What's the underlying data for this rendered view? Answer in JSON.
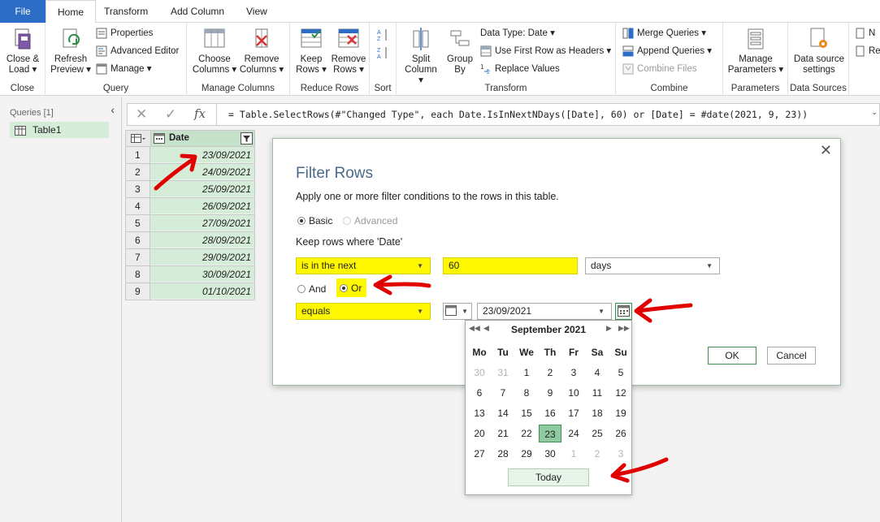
{
  "tabs": [
    {
      "label": "File"
    },
    {
      "label": "Home"
    },
    {
      "label": "Transform"
    },
    {
      "label": "Add Column"
    },
    {
      "label": "View"
    }
  ],
  "ribbon": {
    "close": {
      "btn": "Close &",
      "btn2": "Load ▾",
      "label": "Close"
    },
    "query": {
      "refresh": "Refresh",
      "refresh2": "Preview ▾",
      "properties": "Properties",
      "advanced_editor": "Advanced Editor",
      "manage": "Manage ▾",
      "label": "Query"
    },
    "manage_columns": {
      "choose": "Choose",
      "choose2": "Columns ▾",
      "remove": "Remove",
      "remove2": "Columns ▾",
      "label": "Manage Columns"
    },
    "reduce_rows": {
      "keep": "Keep",
      "keep2": "Rows ▾",
      "remove": "Remove",
      "remove2": "Rows ▾",
      "label": "Reduce Rows"
    },
    "sort": {
      "label": "Sort"
    },
    "transform": {
      "split": "Split",
      "split2": "Column ▾",
      "group": "Group",
      "group2": "By",
      "data_type": "Data Type: Date ▾",
      "first_row": "Use First Row as Headers ▾",
      "replace": "Replace Values",
      "label": "Transform"
    },
    "combine": {
      "merge": "Merge Queries ▾",
      "append": "Append Queries ▾",
      "combine_files": "Combine Files",
      "label": "Combine"
    },
    "parameters": {
      "manage": "Manage",
      "manage2": "Parameters ▾",
      "label": "Parameters"
    },
    "data_sources": {
      "settings": "Data source",
      "settings2": "settings",
      "label": "Data Sources"
    },
    "new_query": {
      "n": "N",
      "r": "Re"
    }
  },
  "left_pane": {
    "header": "Queries [1]",
    "items": [
      {
        "label": "Table1"
      }
    ]
  },
  "formula_bar": {
    "formula": "= Table.SelectRows(#\"Changed Type\", each Date.IsInNextNDays([Date], 60) or [Date] = #date(2021, 9, 23))"
  },
  "grid": {
    "column": "Date",
    "rows": [
      {
        "n": "1",
        "v": "23/09/2021"
      },
      {
        "n": "2",
        "v": "24/09/2021"
      },
      {
        "n": "3",
        "v": "25/09/2021"
      },
      {
        "n": "4",
        "v": "26/09/2021"
      },
      {
        "n": "5",
        "v": "27/09/2021"
      },
      {
        "n": "6",
        "v": "28/09/2021"
      },
      {
        "n": "7",
        "v": "29/09/2021"
      },
      {
        "n": "8",
        "v": "30/09/2021"
      },
      {
        "n": "9",
        "v": "01/10/2021"
      }
    ]
  },
  "dialog": {
    "title": "Filter Rows",
    "description": "Apply one or more filter conditions to the rows in this table.",
    "basic": "Basic",
    "advanced": "Advanced",
    "keep_label": "Keep rows where 'Date'",
    "cond1_op": "is in the next",
    "cond1_value": "60",
    "cond1_unit": "days",
    "and": "And",
    "or": "Or",
    "cond2_op": "equals",
    "cond2_value": "23/09/2021",
    "ok": "OK",
    "cancel": "Cancel"
  },
  "calendar": {
    "month": "September 2021",
    "headers": [
      "Mo",
      "Tu",
      "We",
      "Th",
      "Fr",
      "Sa",
      "Su"
    ],
    "weeks": [
      [
        "30",
        "31",
        "1",
        "2",
        "3",
        "4",
        "5"
      ],
      [
        "6",
        "7",
        "8",
        "9",
        "10",
        "11",
        "12"
      ],
      [
        "13",
        "14",
        "15",
        "16",
        "17",
        "18",
        "19"
      ],
      [
        "20",
        "21",
        "22",
        "23",
        "24",
        "25",
        "26"
      ],
      [
        "27",
        "28",
        "29",
        "30",
        "1",
        "2",
        "3"
      ]
    ],
    "other_month": [
      [
        true,
        true,
        false,
        false,
        false,
        false,
        false
      ],
      [
        false,
        false,
        false,
        false,
        false,
        false,
        false
      ],
      [
        false,
        false,
        false,
        false,
        false,
        false,
        false
      ],
      [
        false,
        false,
        false,
        false,
        false,
        false,
        false
      ],
      [
        false,
        false,
        false,
        false,
        true,
        true,
        true
      ]
    ],
    "selected": "23",
    "today": "Today"
  },
  "colors": {
    "accent": "#2b6cc4",
    "highlight": "#fff700",
    "selection": "#d5ecd9",
    "annotation": "#e00000"
  }
}
